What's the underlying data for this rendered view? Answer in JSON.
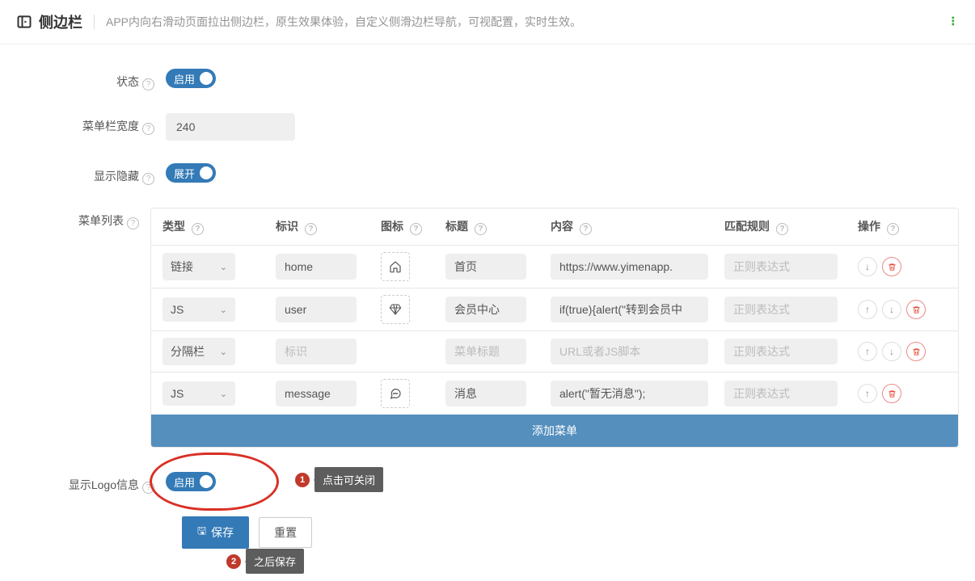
{
  "header": {
    "title": "侧边栏",
    "description": "APP内向右滑动页面拉出侧边栏，原生效果体验，自定义侧滑边栏导航，可视配置，实时生效。"
  },
  "form": {
    "status_label": "状态",
    "status_value": "启用",
    "width_label": "菜单栏宽度",
    "width_value": "240",
    "show_hide_label": "显示隐藏",
    "show_hide_value": "展开",
    "menu_list_label": "菜单列表",
    "logo_label": "显示Logo信息",
    "logo_value": "启用"
  },
  "table": {
    "headers": {
      "type": "类型",
      "ident": "标识",
      "icon": "图标",
      "title": "标题",
      "content": "内容",
      "rule": "匹配规则",
      "ops": "操作"
    },
    "placeholders": {
      "ident": "标识",
      "title": "菜单标题",
      "content": "URL或者JS脚本",
      "rule": "正则表达式"
    },
    "add_label": "添加菜单",
    "rows": [
      {
        "type": "链接",
        "ident": "home",
        "icon": "home",
        "title": "首页",
        "content": "https://www.yimenapp.",
        "rule": "",
        "rule_disabled": false,
        "up": false,
        "down": true,
        "del": true
      },
      {
        "type": "JS",
        "ident": "user",
        "icon": "diamond",
        "title": "会员中心",
        "content": "if(true){alert(\"转到会员中",
        "rule": "",
        "rule_disabled": true,
        "up": true,
        "down": true,
        "del": true
      },
      {
        "type": "分隔栏",
        "ident": "",
        "icon": "",
        "title": "",
        "content": "",
        "rule": "",
        "rule_disabled": true,
        "up": true,
        "down": true,
        "del": true
      },
      {
        "type": "JS",
        "ident": "message",
        "icon": "chat",
        "title": "消息",
        "content": "alert(\"暂无消息\");",
        "rule": "",
        "rule_disabled": true,
        "up": true,
        "down": false,
        "del": true
      }
    ]
  },
  "annotations": {
    "a1_num": "1",
    "a1_text": "点击可关闭",
    "a2_num": "2",
    "a2_text": "之后保存"
  },
  "buttons": {
    "save": "保存",
    "reset": "重置"
  }
}
